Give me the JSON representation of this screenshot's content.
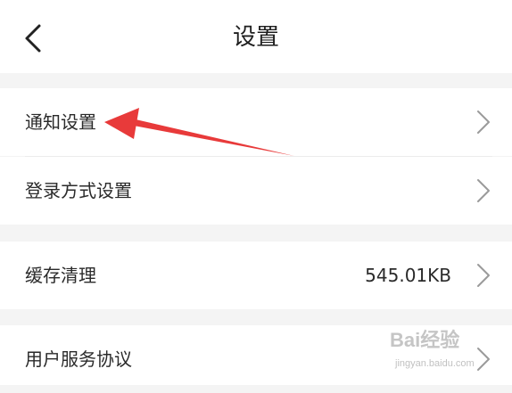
{
  "header": {
    "back_icon": "chevron-left-icon",
    "title": "设置"
  },
  "rows": [
    {
      "label": "通知设置",
      "value": "",
      "chevron_icon": "chevron-right-icon"
    },
    {
      "label": "登录方式设置",
      "value": "",
      "chevron_icon": "chevron-right-icon"
    },
    {
      "label": "缓存清理",
      "value": "545.01KB",
      "chevron_icon": "chevron-right-icon"
    },
    {
      "label": "用户服务协议",
      "value": "",
      "chevron_icon": "chevron-right-icon"
    }
  ],
  "annotation": {
    "type": "red-arrow",
    "color": "#e83a3a",
    "points_to": "通知设置"
  },
  "watermark": {
    "brand": "Bai经验",
    "url": "jingyan.baidu.com"
  },
  "colors": {
    "background": "#f4f4f4",
    "surface": "#ffffff",
    "text": "#222222",
    "chevron": "#9a9a9a",
    "arrow": "#e83a3a"
  }
}
